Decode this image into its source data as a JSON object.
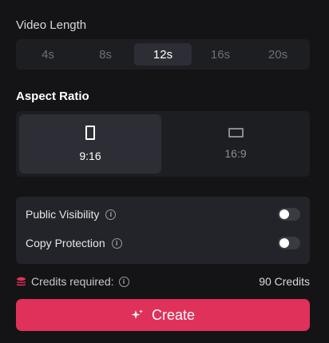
{
  "video_length": {
    "label": "Video Length",
    "options": [
      {
        "label": "4s"
      },
      {
        "label": "8s"
      },
      {
        "label": "12s"
      },
      {
        "label": "16s"
      },
      {
        "label": "20s"
      }
    ],
    "selected": "12s"
  },
  "aspect_ratio": {
    "label": "Aspect Ratio",
    "options": [
      {
        "label": "9:16",
        "icon": "portrait-rect-icon"
      },
      {
        "label": "16:9",
        "icon": "landscape-rect-icon"
      }
    ],
    "selected": "9:16"
  },
  "settings": {
    "public_visibility": {
      "label": "Public Visibility",
      "enabled": false
    },
    "copy_protection": {
      "label": "Copy Protection",
      "enabled": false
    }
  },
  "credits": {
    "label": "Credits required:",
    "value": "90 Credits",
    "icon": "stack-icon"
  },
  "create_button": {
    "label": "Create",
    "icon": "sparkle-icon"
  },
  "colors": {
    "accent": "#e0315b",
    "background": "#141416",
    "panel": "#1d1e22",
    "active": "#2d2e35"
  }
}
